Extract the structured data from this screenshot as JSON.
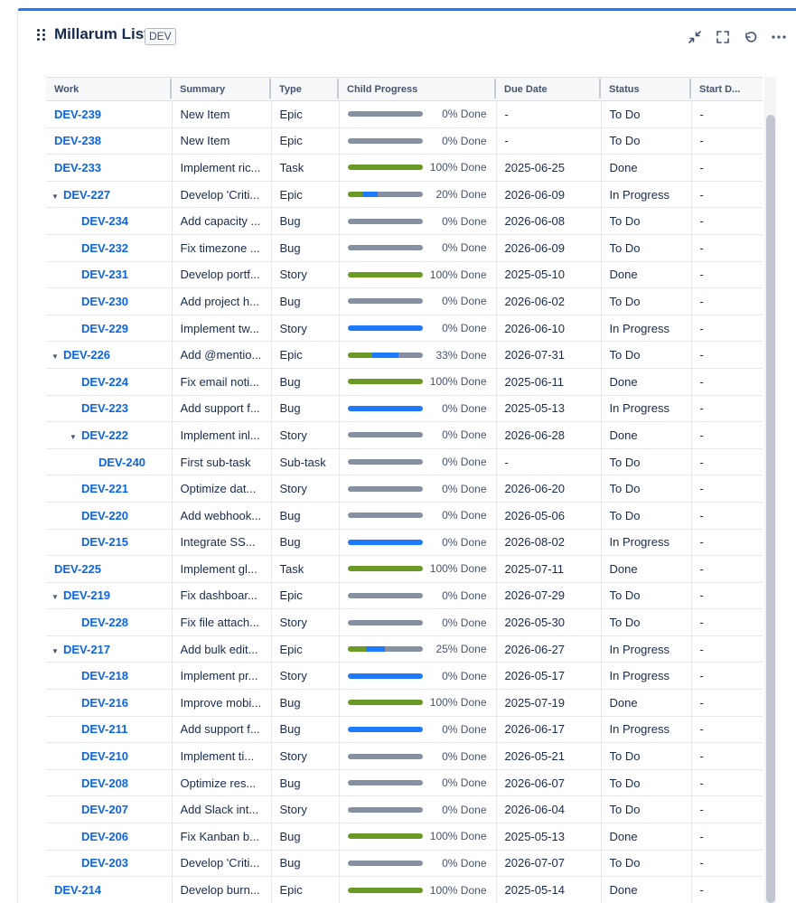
{
  "header": {
    "title": "Millarum List",
    "badge": "DEV"
  },
  "columns": [
    "Work",
    "Summary",
    "Type",
    "Child Progress",
    "Due Date",
    "Status",
    "Start D..."
  ],
  "rows": [
    {
      "key": "DEV-239",
      "level": 0,
      "caret": false,
      "summary": "New Item",
      "type": "Epic",
      "progress": {
        "done": 0,
        "inprog": 0
      },
      "pct": "0% Done",
      "due": "-",
      "status": "To Do",
      "start": "-"
    },
    {
      "key": "DEV-238",
      "level": 0,
      "caret": false,
      "summary": "New Item",
      "type": "Epic",
      "progress": {
        "done": 0,
        "inprog": 0
      },
      "pct": "0% Done",
      "due": "-",
      "status": "To Do",
      "start": "-"
    },
    {
      "key": "DEV-233",
      "level": 0,
      "caret": false,
      "summary": "Implement ric...",
      "type": "Task",
      "progress": {
        "done": 100,
        "inprog": 0
      },
      "pct": "100% Done",
      "due": "2025-06-25",
      "status": "Done",
      "start": "-"
    },
    {
      "key": "DEV-227",
      "level": 0,
      "caret": true,
      "summary": "Develop 'Criti...",
      "type": "Epic",
      "progress": {
        "done": 20,
        "inprog": 20
      },
      "pct": "20% Done",
      "due": "2026-06-09",
      "status": "In Progress",
      "start": "-"
    },
    {
      "key": "DEV-234",
      "level": 1,
      "caret": false,
      "summary": "Add capacity ...",
      "type": "Bug",
      "progress": {
        "done": 0,
        "inprog": 0
      },
      "pct": "0% Done",
      "due": "2026-06-08",
      "status": "To Do",
      "start": "-"
    },
    {
      "key": "DEV-232",
      "level": 1,
      "caret": false,
      "summary": "Fix timezone ...",
      "type": "Bug",
      "progress": {
        "done": 0,
        "inprog": 0
      },
      "pct": "0% Done",
      "due": "2026-06-09",
      "status": "To Do",
      "start": "-"
    },
    {
      "key": "DEV-231",
      "level": 1,
      "caret": false,
      "summary": "Develop portf...",
      "type": "Story",
      "progress": {
        "done": 100,
        "inprog": 0
      },
      "pct": "100% Done",
      "due": "2025-05-10",
      "status": "Done",
      "start": "-"
    },
    {
      "key": "DEV-230",
      "level": 1,
      "caret": false,
      "summary": "Add project h...",
      "type": "Bug",
      "progress": {
        "done": 0,
        "inprog": 0
      },
      "pct": "0% Done",
      "due": "2026-06-02",
      "status": "To Do",
      "start": "-"
    },
    {
      "key": "DEV-229",
      "level": 1,
      "caret": false,
      "summary": "Implement tw...",
      "type": "Story",
      "progress": {
        "done": 0,
        "inprog": 100
      },
      "pct": "0% Done",
      "due": "2026-06-10",
      "status": "In Progress",
      "start": "-"
    },
    {
      "key": "DEV-226",
      "level": 0,
      "caret": true,
      "summary": "Add @mentio...",
      "type": "Epic",
      "progress": {
        "done": 33,
        "inprog": 34
      },
      "pct": "33% Done",
      "due": "2026-07-31",
      "status": "To Do",
      "start": "-"
    },
    {
      "key": "DEV-224",
      "level": 1,
      "caret": false,
      "summary": "Fix email noti...",
      "type": "Bug",
      "progress": {
        "done": 100,
        "inprog": 0
      },
      "pct": "100% Done",
      "due": "2025-06-11",
      "status": "Done",
      "start": "-"
    },
    {
      "key": "DEV-223",
      "level": 1,
      "caret": false,
      "summary": "Add support f...",
      "type": "Bug",
      "progress": {
        "done": 0,
        "inprog": 100
      },
      "pct": "0% Done",
      "due": "2025-05-13",
      "status": "In Progress",
      "start": "-"
    },
    {
      "key": "DEV-222",
      "level": 1,
      "caret": true,
      "summary": "Implement inl...",
      "type": "Story",
      "progress": {
        "done": 0,
        "inprog": 0
      },
      "pct": "0% Done",
      "due": "2026-06-28",
      "status": "Done",
      "start": "-"
    },
    {
      "key": "DEV-240",
      "level": 2,
      "caret": false,
      "summary": "First sub-task",
      "type": "Sub-task",
      "progress": {
        "done": 0,
        "inprog": 0
      },
      "pct": "0% Done",
      "due": "-",
      "status": "To Do",
      "start": "-"
    },
    {
      "key": "DEV-221",
      "level": 1,
      "caret": false,
      "summary": "Optimize dat...",
      "type": "Story",
      "progress": {
        "done": 0,
        "inprog": 0
      },
      "pct": "0% Done",
      "due": "2026-06-20",
      "status": "To Do",
      "start": "-"
    },
    {
      "key": "DEV-220",
      "level": 1,
      "caret": false,
      "summary": "Add webhook...",
      "type": "Bug",
      "progress": {
        "done": 0,
        "inprog": 0
      },
      "pct": "0% Done",
      "due": "2026-05-06",
      "status": "To Do",
      "start": "-"
    },
    {
      "key": "DEV-215",
      "level": 1,
      "caret": false,
      "summary": "Integrate SS...",
      "type": "Bug",
      "progress": {
        "done": 0,
        "inprog": 100
      },
      "pct": "0% Done",
      "due": "2026-08-02",
      "status": "In Progress",
      "start": "-"
    },
    {
      "key": "DEV-225",
      "level": 0,
      "caret": false,
      "summary": "Implement gl...",
      "type": "Task",
      "progress": {
        "done": 100,
        "inprog": 0
      },
      "pct": "100% Done",
      "due": "2025-07-11",
      "status": "Done",
      "start": "-"
    },
    {
      "key": "DEV-219",
      "level": 0,
      "caret": true,
      "summary": "Fix dashboar...",
      "type": "Epic",
      "progress": {
        "done": 0,
        "inprog": 0
      },
      "pct": "0% Done",
      "due": "2026-07-29",
      "status": "To Do",
      "start": "-"
    },
    {
      "key": "DEV-228",
      "level": 1,
      "caret": false,
      "summary": "Fix file attach...",
      "type": "Story",
      "progress": {
        "done": 0,
        "inprog": 0
      },
      "pct": "0% Done",
      "due": "2026-05-30",
      "status": "To Do",
      "start": "-"
    },
    {
      "key": "DEV-217",
      "level": 0,
      "caret": true,
      "summary": "Add bulk edit...",
      "type": "Epic",
      "progress": {
        "done": 25,
        "inprog": 25
      },
      "pct": "25% Done",
      "due": "2026-06-27",
      "status": "In Progress",
      "start": "-"
    },
    {
      "key": "DEV-218",
      "level": 1,
      "caret": false,
      "summary": "Implement pr...",
      "type": "Story",
      "progress": {
        "done": 0,
        "inprog": 100
      },
      "pct": "0% Done",
      "due": "2026-05-17",
      "status": "In Progress",
      "start": "-"
    },
    {
      "key": "DEV-216",
      "level": 1,
      "caret": false,
      "summary": "Improve mobi...",
      "type": "Bug",
      "progress": {
        "done": 100,
        "inprog": 0
      },
      "pct": "100% Done",
      "due": "2025-07-19",
      "status": "Done",
      "start": "-"
    },
    {
      "key": "DEV-211",
      "level": 1,
      "caret": false,
      "summary": "Add support f...",
      "type": "Bug",
      "progress": {
        "done": 0,
        "inprog": 100
      },
      "pct": "0% Done",
      "due": "2026-06-17",
      "status": "In Progress",
      "start": "-"
    },
    {
      "key": "DEV-210",
      "level": 1,
      "caret": false,
      "summary": "Implement ti...",
      "type": "Story",
      "progress": {
        "done": 0,
        "inprog": 0
      },
      "pct": "0% Done",
      "due": "2026-05-21",
      "status": "To Do",
      "start": "-"
    },
    {
      "key": "DEV-208",
      "level": 1,
      "caret": false,
      "summary": "Optimize res...",
      "type": "Bug",
      "progress": {
        "done": 0,
        "inprog": 0
      },
      "pct": "0% Done",
      "due": "2026-06-07",
      "status": "To Do",
      "start": "-"
    },
    {
      "key": "DEV-207",
      "level": 1,
      "caret": false,
      "summary": "Add Slack int...",
      "type": "Story",
      "progress": {
        "done": 0,
        "inprog": 0
      },
      "pct": "0% Done",
      "due": "2026-06-04",
      "status": "To Do",
      "start": "-"
    },
    {
      "key": "DEV-206",
      "level": 1,
      "caret": false,
      "summary": "Fix Kanban b...",
      "type": "Bug",
      "progress": {
        "done": 100,
        "inprog": 0
      },
      "pct": "100% Done",
      "due": "2025-05-13",
      "status": "Done",
      "start": "-"
    },
    {
      "key": "DEV-203",
      "level": 1,
      "caret": false,
      "summary": "Develop 'Criti...",
      "type": "Bug",
      "progress": {
        "done": 0,
        "inprog": 0
      },
      "pct": "0% Done",
      "due": "2026-07-07",
      "status": "To Do",
      "start": "-"
    },
    {
      "key": "DEV-214",
      "level": 0,
      "caret": false,
      "summary": "Develop burn...",
      "type": "Epic",
      "progress": {
        "done": 100,
        "inprog": 0
      },
      "pct": "100% Done",
      "due": "2025-05-14",
      "status": "Done",
      "start": "-"
    }
  ],
  "colors": {
    "accent": "#1d7afc",
    "link": "#0c66e4",
    "done": "#6a9a23",
    "inprogress": "#1d7afc",
    "todo": "#8590a2"
  },
  "icons": [
    "drag-handle-icon",
    "collapse-icon",
    "fullscreen-icon",
    "refresh-icon",
    "more-icon",
    "caret-down-icon"
  ]
}
